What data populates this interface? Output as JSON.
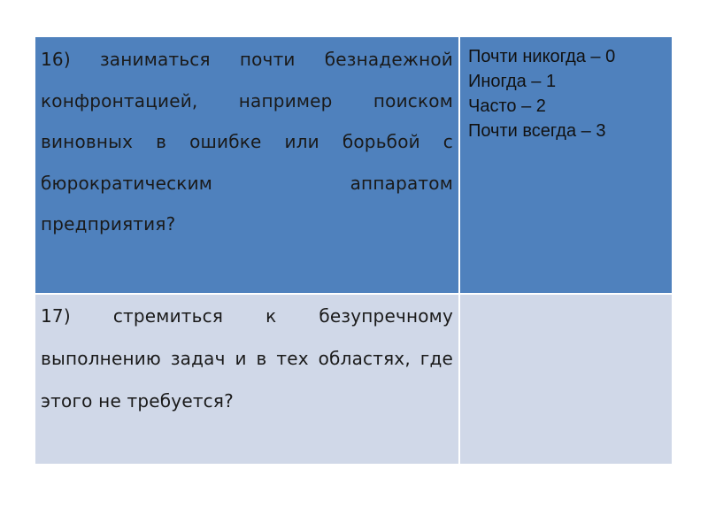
{
  "table": {
    "rows": [
      {
        "question": "16) заниматься почти безнадежной конфронтацией, например поиском виновных в ошибке или борьбой с бюрократическим аппаратом предприятия?",
        "scale": [
          "Почти никогда – 0",
          "Иногда – 1",
          "Часто – 2",
          "Почти всегда – 3"
        ]
      },
      {
        "question": "17) стремиться к безупречному выполнению задач и в тех областях, где этого не требуется?",
        "scale": []
      }
    ],
    "colors": {
      "header_row": "#4f81bd",
      "body_row": "#d0d8e8"
    }
  }
}
